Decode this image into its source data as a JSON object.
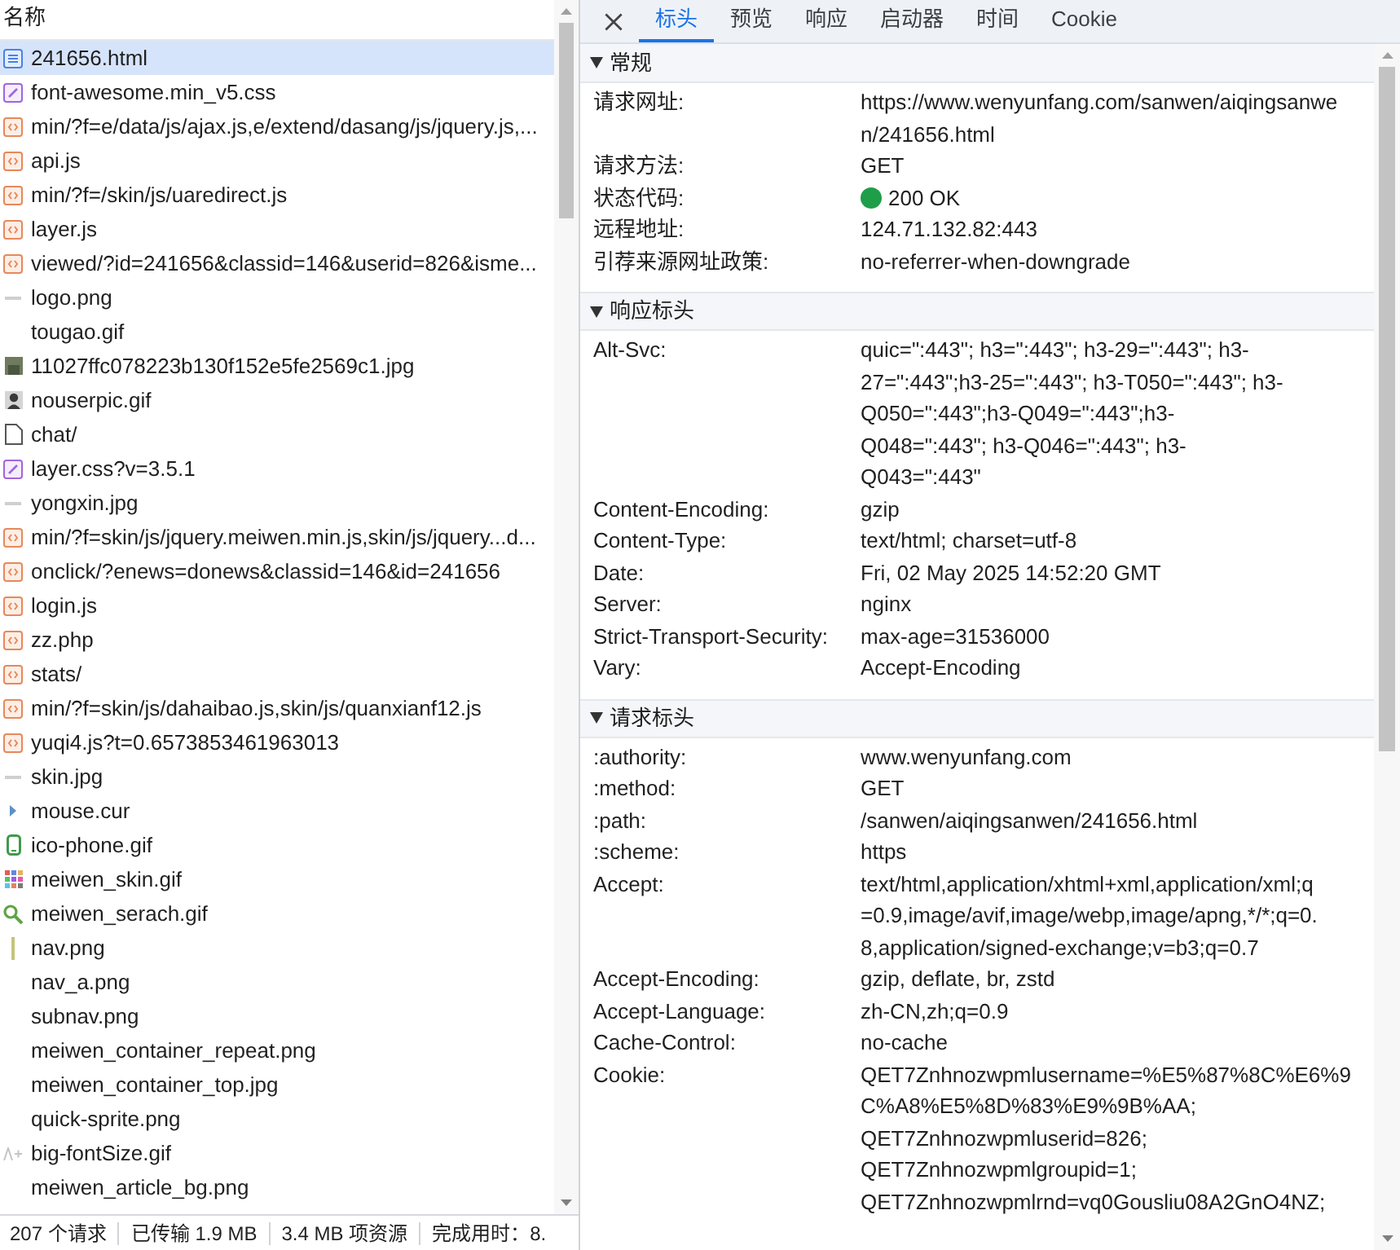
{
  "request_list": {
    "header": "名称",
    "rows": [
      {
        "name": "241656.html",
        "kind": "document",
        "selected": true
      },
      {
        "name": "font-awesome.min_v5.css",
        "kind": "stylesheet",
        "selected": false
      },
      {
        "name": "min/?f=e/data/js/ajax.js,e/extend/dasang/js/jquery.js,...",
        "kind": "script",
        "selected": false
      },
      {
        "name": "api.js",
        "kind": "script",
        "selected": false
      },
      {
        "name": "min/?f=/skin/js/uaredirect.js",
        "kind": "script",
        "selected": false
      },
      {
        "name": "layer.js",
        "kind": "script",
        "selected": false
      },
      {
        "name": "viewed/?id=241656&classid=146&userid=826&isme...",
        "kind": "script",
        "selected": false
      },
      {
        "name": "logo.png",
        "kind": "dash",
        "selected": false
      },
      {
        "name": "tougao.gif",
        "kind": "image",
        "selected": false
      },
      {
        "name": "11027ffc078223b130f152e5fe2569c1.jpg",
        "kind": "photo",
        "selected": false
      },
      {
        "name": "nouserpic.gif",
        "kind": "avatar",
        "selected": false
      },
      {
        "name": "chat/",
        "kind": "file",
        "selected": false
      },
      {
        "name": "layer.css?v=3.5.1",
        "kind": "stylesheet",
        "selected": false
      },
      {
        "name": "yongxin.jpg",
        "kind": "dash",
        "selected": false
      },
      {
        "name": "min/?f=skin/js/jquery.meiwen.min.js,skin/js/jquery...d...",
        "kind": "script",
        "selected": false
      },
      {
        "name": "onclick/?enews=donews&classid=146&id=241656",
        "kind": "script",
        "selected": false
      },
      {
        "name": "login.js",
        "kind": "script",
        "selected": false
      },
      {
        "name": "zz.php",
        "kind": "script",
        "selected": false
      },
      {
        "name": "stats/",
        "kind": "script",
        "selected": false
      },
      {
        "name": "min/?f=skin/js/dahaibao.js,skin/js/quanxianf12.js",
        "kind": "script",
        "selected": false
      },
      {
        "name": "yuqi4.js?t=0.6573853461963013",
        "kind": "script",
        "selected": false
      },
      {
        "name": "skin.jpg",
        "kind": "dash",
        "selected": false
      },
      {
        "name": "mouse.cur",
        "kind": "cursor",
        "selected": false
      },
      {
        "name": "ico-phone.gif",
        "kind": "phone",
        "selected": false
      },
      {
        "name": "meiwen_skin.gif",
        "kind": "grid",
        "selected": false
      },
      {
        "name": "meiwen_serach.gif",
        "kind": "magnifier",
        "selected": false
      },
      {
        "name": "nav.png",
        "kind": "bar",
        "selected": false
      },
      {
        "name": "nav_a.png",
        "kind": "image",
        "selected": false
      },
      {
        "name": "subnav.png",
        "kind": "image",
        "selected": false
      },
      {
        "name": "meiwen_container_repeat.png",
        "kind": "image",
        "selected": false
      },
      {
        "name": "meiwen_container_top.jpg",
        "kind": "image",
        "selected": false
      },
      {
        "name": "quick-sprite.png",
        "kind": "image",
        "selected": false
      },
      {
        "name": "big-fontSize.gif",
        "kind": "fontsize",
        "selected": false
      },
      {
        "name": "meiwen_article_bg.png",
        "kind": "image",
        "selected": false
      }
    ]
  },
  "status_bar": {
    "items": [
      "207 个请求",
      "已传输 1.9 MB",
      "3.4 MB 项资源",
      "完成用时：8."
    ]
  },
  "tabs": [
    {
      "label": "标头",
      "selected": true
    },
    {
      "label": "预览",
      "selected": false
    },
    {
      "label": "响应",
      "selected": false
    },
    {
      "label": "启动器",
      "selected": false
    },
    {
      "label": "时间",
      "selected": false
    },
    {
      "label": "Cookie",
      "selected": false
    }
  ],
  "sections": [
    {
      "title": "常规",
      "expanded": true,
      "rows": [
        {
          "label": "请求网址:",
          "value": [
            "https://www.wenyunfang.com/sanwen/aiqingsanwe",
            "n/241656.html"
          ]
        },
        {
          "label": "请求方法:",
          "value": [
            "GET"
          ]
        },
        {
          "label": "状态代码:",
          "value": [
            "200 OK"
          ],
          "color": "#1e9e48"
        },
        {
          "label": "远程地址:",
          "value": [
            "124.71.132.82:443"
          ]
        },
        {
          "label": "引荐来源网址政策:",
          "value": [
            "no-referrer-when-downgrade"
          ]
        }
      ]
    },
    {
      "title": "响应标头",
      "expanded": true,
      "rows": [
        {
          "label": "Alt-Svc:",
          "value": [
            "quic=\":443\"; h3=\":443\"; h3-29=\":443\"; h3-",
            "27=\":443\";h3-25=\":443\"; h3-T050=\":443\"; h3-",
            "Q050=\":443\";h3-Q049=\":443\";h3-",
            "Q048=\":443\"; h3-Q046=\":443\"; h3-",
            "Q043=\":443\""
          ]
        },
        {
          "label": "Content-Encoding:",
          "value": [
            "gzip"
          ]
        },
        {
          "label": "Content-Type:",
          "value": [
            "text/html; charset=utf-8"
          ]
        },
        {
          "label": "Date:",
          "value": [
            "Fri, 02 May 2025 14:52:20 GMT"
          ]
        },
        {
          "label": "Server:",
          "value": [
            "nginx"
          ]
        },
        {
          "label": "Strict-Transport-Security:",
          "value": [
            "max-age=31536000"
          ]
        },
        {
          "label": "Vary:",
          "value": [
            "Accept-Encoding"
          ]
        }
      ]
    },
    {
      "title": "请求标头",
      "expanded": true,
      "rows": [
        {
          "label": ":authority:",
          "value": [
            "www.wenyunfang.com"
          ]
        },
        {
          "label": ":method:",
          "value": [
            "GET"
          ]
        },
        {
          "label": ":path:",
          "value": [
            "/sanwen/aiqingsanwen/241656.html"
          ]
        },
        {
          "label": ":scheme:",
          "value": [
            "https"
          ]
        },
        {
          "label": "Accept:",
          "value": [
            "text/html,application/xhtml+xml,application/xml;q",
            "=0.9,image/avif,image/webp,image/apng,*/*;q=0.",
            "8,application/signed-exchange;v=b3;q=0.7"
          ]
        },
        {
          "label": "Accept-Encoding:",
          "value": [
            "gzip, deflate, br, zstd"
          ]
        },
        {
          "label": "Accept-Language:",
          "value": [
            "zh-CN,zh;q=0.9"
          ]
        },
        {
          "label": "Cache-Control:",
          "value": [
            "no-cache"
          ]
        },
        {
          "label": "Cookie:",
          "value": [
            "QET7Znhnozwpmlusername=%E5%87%8C%E6%9",
            "C%A8%E5%8D%83%E9%9B%AA;",
            "QET7Znhnozwpmluserid=826;",
            "QET7Znhnozwpmlgroupid=1;",
            "QET7Znhnozwpmlrnd=vq0Gousliu08A2GnO4NZ;"
          ]
        }
      ]
    }
  ]
}
